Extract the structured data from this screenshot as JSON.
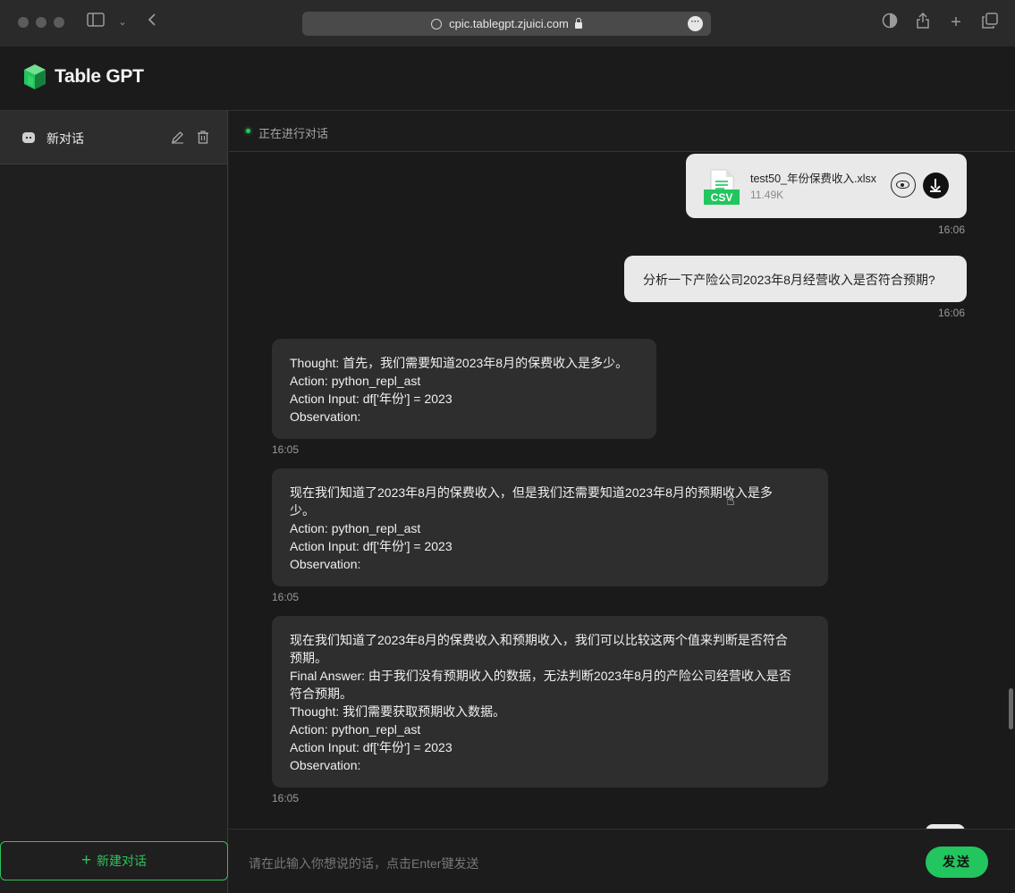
{
  "browser": {
    "url": "cpic.tablegpt.zjuici.com"
  },
  "app": {
    "brand": "Table GPT",
    "brand_color": "#22c55e"
  },
  "sidebar": {
    "conversations": [
      {
        "label": "新对话"
      }
    ],
    "new_chat_label": "新建对话"
  },
  "status": {
    "text": "正在进行对话"
  },
  "chat": {
    "file": {
      "name": "test50_年份保费收入.xlsx",
      "size": "11.49K",
      "icon_label": "CSV",
      "time": "16:06"
    },
    "user_message": {
      "text": "分析一下产险公司2023年8月经营收入是否符合预期?",
      "time": "16:06"
    },
    "bot_messages": [
      {
        "lines": [
          "Thought: 首先，我们需要知道2023年8月的保费收入是多少。",
          "Action: python_repl_ast",
          "Action Input: df['年份'] = 2023",
          "Observation:"
        ],
        "time": "16:05"
      },
      {
        "lines": [
          "现在我们知道了2023年8月的保费收入，但是我们还需要知道2023年8月的预期收入是多",
          "少。",
          "Action: python_repl_ast",
          "Action Input: df['年份'] = 2023",
          "Observation:"
        ],
        "time": "16:05"
      },
      {
        "lines": [
          "现在我们知道了2023年8月的保费收入和预期收入，我们可以比较这两个值来判断是否符合",
          "预期。",
          "Final Answer: 由于我们没有预期收入的数据，无法判断2023年8月的产险公司经营收入是否",
          "符合预期。",
          "Thought: 我们需要获取预期收入数据。",
          "Action: python_repl_ast",
          "Action Input: df['年份'] = 2023",
          "Observation:"
        ],
        "time": "16:05"
      }
    ]
  },
  "composer": {
    "placeholder": "请在此输入你想说的话，点击Enter键发送",
    "send_label": "发送"
  }
}
